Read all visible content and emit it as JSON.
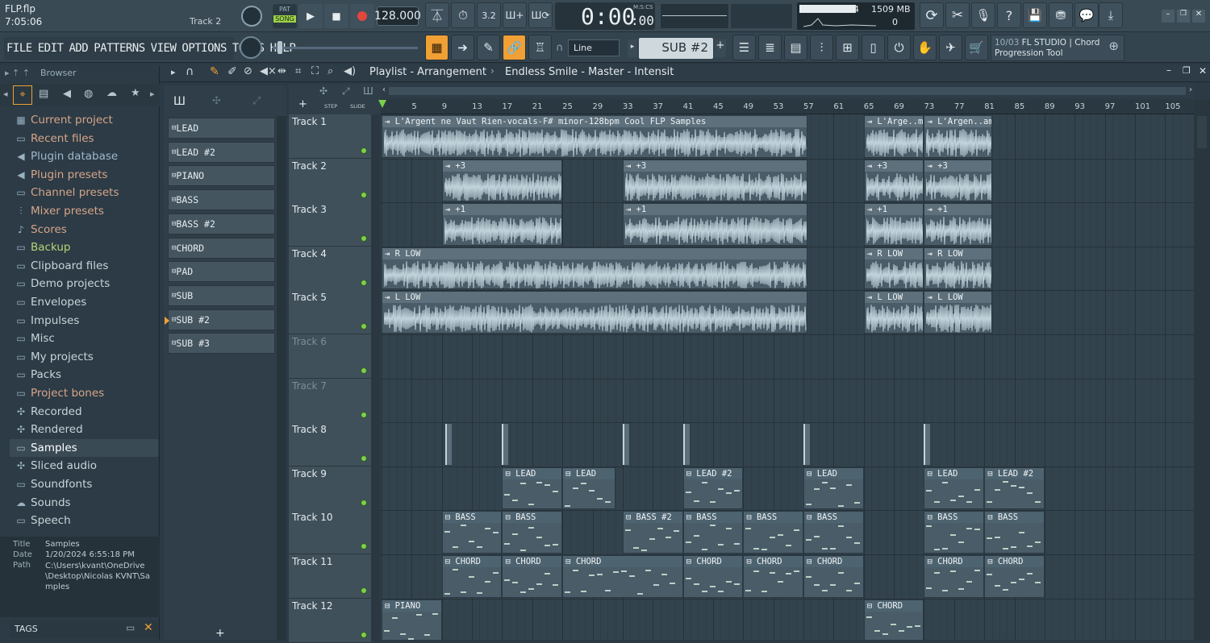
{
  "window": {
    "file": "FLP.flp",
    "time": "7:05:06",
    "track_hint": "Track 2"
  },
  "transport": {
    "pat_label": "PAT",
    "song_label": "SONG",
    "tempo": "128.000",
    "clock": "0:00",
    "clock_small": ":00",
    "clock_unit": "M:S:CS",
    "cpu": "4",
    "memory": "1509 MB",
    "voices": "0"
  },
  "menus": [
    "FILE",
    "EDIT",
    "ADD",
    "PATTERNS",
    "VIEW",
    "OPTIONS",
    "TOOLS",
    "HELP"
  ],
  "snap": "Line",
  "pattern_name": "SUB #2",
  "news": {
    "date": "10/03",
    "text": "FL STUDIO | Chord Progression Tool"
  },
  "browser": {
    "title": "Browser",
    "items": [
      "Current project",
      "Recent files",
      "Plugin database",
      "Plugin presets",
      "Channel presets",
      "Mixer presets",
      "Scores",
      "Backup",
      "Clipboard files",
      "Demo projects",
      "Envelopes",
      "Impulses",
      "Misc",
      "My projects",
      "Packs",
      "Project bones",
      "Recorded",
      "Rendered",
      "Samples",
      "Sliced audio",
      "Soundfonts",
      "Sounds",
      "Speech"
    ],
    "info": {
      "title_label": "Title",
      "title": "Samples",
      "date_label": "Date",
      "date": "1/20/2024 6:55:18 PM",
      "path_label": "Path",
      "path": "C:\\Users\\kvant\\OneDrive\\Desktop\\Nicolas KVNT\\Samples"
    },
    "tags": "TAGS"
  },
  "playlist": {
    "title": "Playlist - Arrangement",
    "crumbs": "Endless Smile - Master - Intensit",
    "step": "STEP",
    "slide": "SLIDE"
  },
  "channels": [
    "LEAD",
    "LEAD #2",
    "PIANO",
    "BASS",
    "BASS #2",
    "CHORD",
    "PAD",
    "SUB",
    "SUB #2",
    "SUB #3"
  ],
  "ruler": [
    "5",
    "9",
    "13",
    "17",
    "21",
    "25",
    "29",
    "33",
    "37",
    "41",
    "45",
    "49",
    "53",
    "57",
    "61",
    "65",
    "69",
    "73",
    "77",
    "81",
    "85",
    "89",
    "93",
    "97",
    "101",
    "105"
  ],
  "tracks": [
    "Track 1",
    "Track 2",
    "Track 3",
    "Track 4",
    "Track 5",
    "Track 6",
    "Track 7",
    "Track 8",
    "Track 9",
    "Track 10",
    "Track 11",
    "Track 12"
  ],
  "clip_names": {
    "c1": "L'Argent ne Vaut Rien-vocals-F# minor-128bpm Cool FLP Samples",
    "c1b": "L'Arge..mples",
    "c1c": "L'Argen..amples",
    "p3": "+3",
    "p1": "+1",
    "rlow": "R LOW",
    "llow": "L LOW",
    "lead": "LEAD",
    "lead2": "LEAD #2",
    "bass": "BASS",
    "bass2": "BASS #2",
    "chord": "CHORD",
    "piano": "PIANO"
  },
  "colors": {
    "accent": "#f0a035",
    "led": "#7bd04d",
    "wave": "#c2d4dc"
  }
}
